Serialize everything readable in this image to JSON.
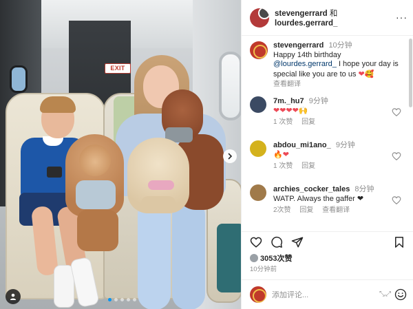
{
  "photo": {
    "exit_sign": "EXIT",
    "carousel": {
      "total": 5,
      "active": 1
    }
  },
  "header": {
    "user1": "stevengerrard",
    "and": "和",
    "user2": "lourdes.gerrard_"
  },
  "caption": {
    "username": "stevengerrard",
    "time": "10分钟",
    "line1": "Happy 14th birthday",
    "mention": "@lourdes.gerrard_",
    "text": " I hope your day is special like you are to us ",
    "translate": "查看翻译"
  },
  "comments": [
    {
      "username": "7m._hu7",
      "time": "9分钟",
      "text": "❤❤❤❤🙌",
      "replies": "1 次赞",
      "reply_label": "回复",
      "avatar_color": "#3b4a63"
    },
    {
      "username": "abdou_mi1ano_",
      "time": "9分钟",
      "text": "🔥❤",
      "replies": "1 次赞",
      "reply_label": "回复",
      "avatar_color": "#d4b21d"
    },
    {
      "username": "archies_cocker_tales",
      "time": "8分钟",
      "text": "WATP. Always the gaffer ❤",
      "replies": "2次赞",
      "reply_label": "回复",
      "translate": "查看翻译",
      "avatar_color": "#a07a4a"
    }
  ],
  "likes": {
    "count": "3053次赞"
  },
  "post_time": "10分钟前",
  "add_comment": {
    "placeholder": "添加评论..."
  },
  "colors": {
    "heart": "#ed4956",
    "mention": "#00376b",
    "muted": "#8e8e8e",
    "accent": "#0095f6"
  }
}
